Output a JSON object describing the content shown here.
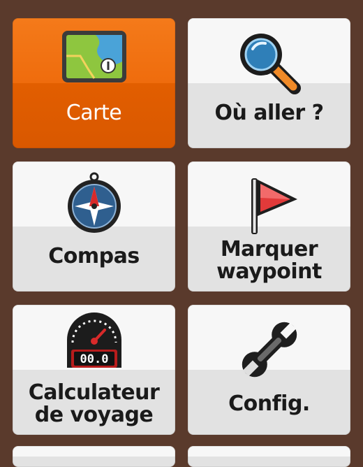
{
  "menu": {
    "items": [
      {
        "label": "Carte",
        "icon": "map-icon",
        "selected": true
      },
      {
        "label": "Où aller ?",
        "icon": "magnifier-icon",
        "selected": false
      },
      {
        "label": "Compas",
        "icon": "compass-icon",
        "selected": false
      },
      {
        "label_line1": "Marquer",
        "label_line2": "waypoint",
        "icon": "flag-icon",
        "selected": false
      },
      {
        "label_line1": "Calculateur",
        "label_line2": "de voyage",
        "icon": "trip-computer-icon",
        "selected": false
      },
      {
        "label": "Config.",
        "icon": "wrench-icon",
        "selected": false
      }
    ],
    "trip_readout": "00.0"
  },
  "colors": {
    "background": "#5a3a2c",
    "selected_tile": "#ef6c0d",
    "tile": "#f2f2f2"
  }
}
